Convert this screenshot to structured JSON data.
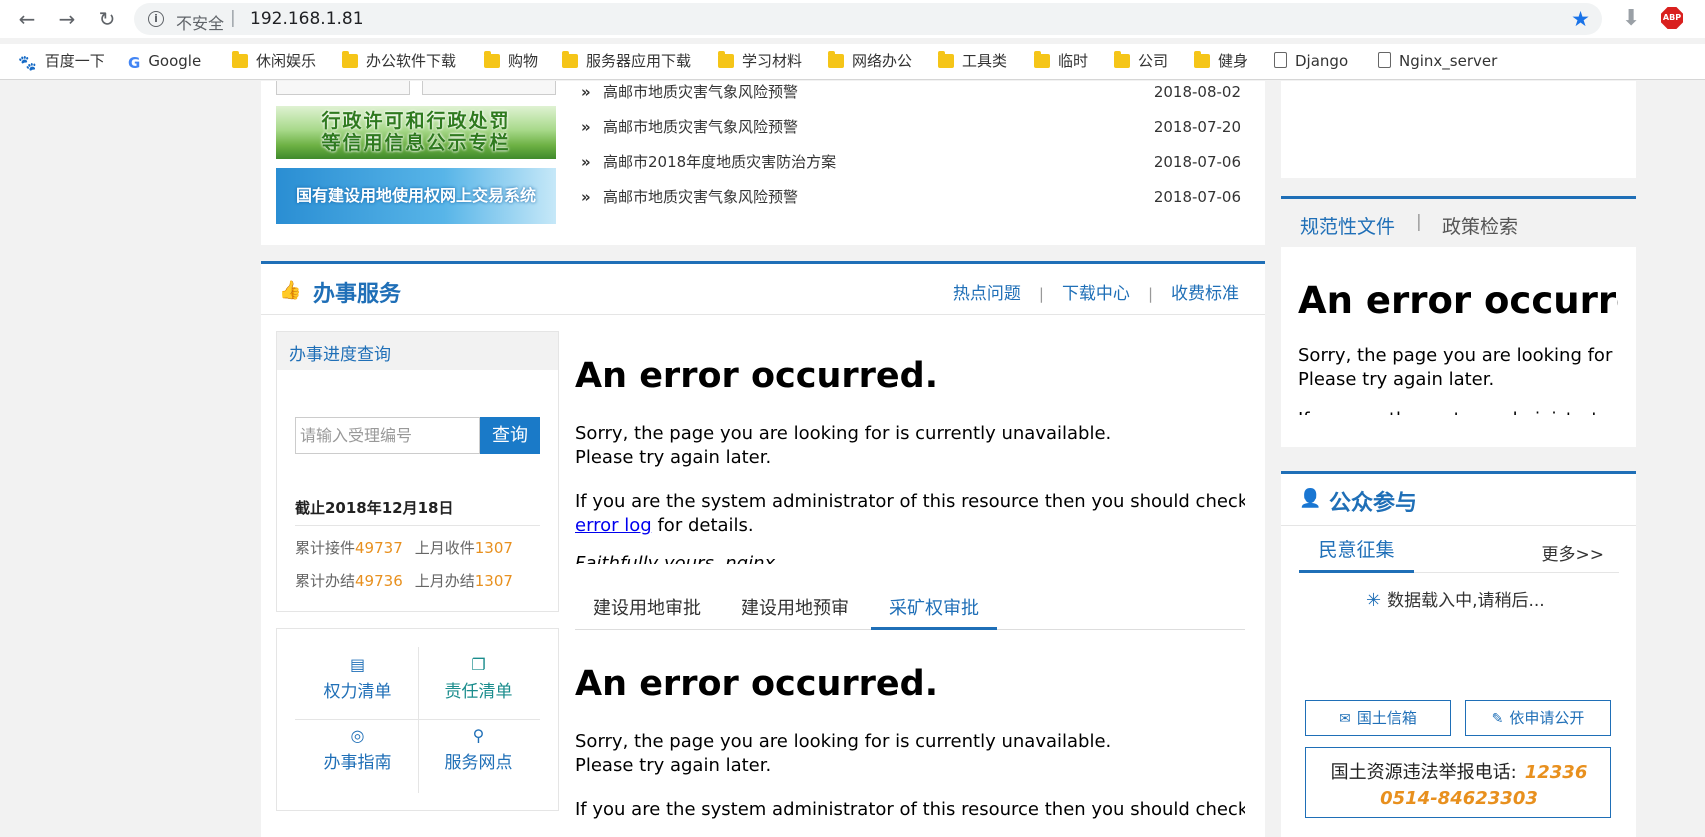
{
  "browser": {
    "security_label": "不安全",
    "separator": "|",
    "url": "192.168.1.81",
    "bookmarks": [
      {
        "label": "百度一下",
        "icon": "baidu-icon"
      },
      {
        "label": "Google",
        "icon": "google-icon"
      },
      {
        "label": "休闲娱乐",
        "icon": "folder-icon"
      },
      {
        "label": "办公软件下载",
        "icon": "folder-icon"
      },
      {
        "label": "购物",
        "icon": "folder-icon"
      },
      {
        "label": "服务器应用下载",
        "icon": "folder-icon"
      },
      {
        "label": "学习材料",
        "icon": "folder-icon"
      },
      {
        "label": "网络办公",
        "icon": "folder-icon"
      },
      {
        "label": "工具类",
        "icon": "folder-icon"
      },
      {
        "label": "临时",
        "icon": "folder-icon"
      },
      {
        "label": "公司",
        "icon": "folder-icon"
      },
      {
        "label": "健身",
        "icon": "folder-icon"
      },
      {
        "label": "Django",
        "icon": "page-icon"
      },
      {
        "label": "Nginx_server",
        "icon": "page-icon"
      }
    ],
    "abp_label": "ABP"
  },
  "top": {
    "banners": [
      {
        "label": "行政许可和行政处罚\n等信用信息公示专栏"
      },
      {
        "label": "国有建设用地使用权网上交易系统"
      }
    ],
    "news": [
      {
        "title": "高邮市地质灾害气象风险预警",
        "date": "2018-08-02"
      },
      {
        "title": "高邮市地质灾害气象风险预警",
        "date": "2018-07-20"
      },
      {
        "title": "高邮市2018年度地质灾害防治方案",
        "date": "2018-07-06"
      },
      {
        "title": "高邮市地质灾害气象风险预警",
        "date": "2018-07-06"
      }
    ],
    "bullet": "»"
  },
  "service": {
    "title": "办事服务",
    "links": [
      "热点问题",
      "下载中心",
      "收费标准"
    ],
    "link_sep": "|",
    "progress_title": "办事进度查询",
    "search_placeholder": "请输入受理编号",
    "search_button": "查询",
    "as_of": "截止2018年12月18日",
    "stats": [
      [
        {
          "label": "累计接件",
          "value": "49737"
        },
        {
          "label": "上月收件",
          "value": "1307"
        }
      ],
      [
        {
          "label": "累计办结",
          "value": "49736"
        },
        {
          "label": "上月办结",
          "value": "1307"
        }
      ]
    ],
    "quick": [
      {
        "label": "权力清单",
        "icon": "document-icon"
      },
      {
        "label": "责任清单",
        "icon": "copy-icon"
      },
      {
        "label": "办事指南",
        "icon": "compass-icon"
      },
      {
        "label": "服务网点",
        "icon": "location-pin-icon"
      }
    ],
    "tabs": [
      {
        "label": "建设用地审批",
        "active": false
      },
      {
        "label": "建设用地预审",
        "active": false
      },
      {
        "label": "采矿权审批",
        "active": true
      }
    ]
  },
  "error": {
    "heading": "An error occurred.",
    "line1": "Sorry, the page you are looking for is currently unavailable.",
    "line2": "Please try again later.",
    "admin_prefix": "If you are the system administrator of this resource then you should check t",
    "link": "error log",
    "suffix": " for details.",
    "faithfully": "Faithfully yours, nginx."
  },
  "right": {
    "policy_tabs": [
      "规范性文件",
      "政策检索"
    ],
    "policy_sep": "|",
    "error_line1": "Sorry, the page you are looking for i",
    "error_line2": "Please try again later.",
    "public_title": "公众参与",
    "public_tab": "民意征集",
    "more": "更多>>",
    "loading": "数据载入中,请稍后...",
    "buttons": [
      {
        "label": "国土信箱",
        "icon": "mail-icon"
      },
      {
        "label": "依申请公开",
        "icon": "edit-icon"
      }
    ],
    "hotline_label": "国土资源违法举报电话:",
    "hotline_1": "12336",
    "hotline_2": "0514-84623303"
  }
}
